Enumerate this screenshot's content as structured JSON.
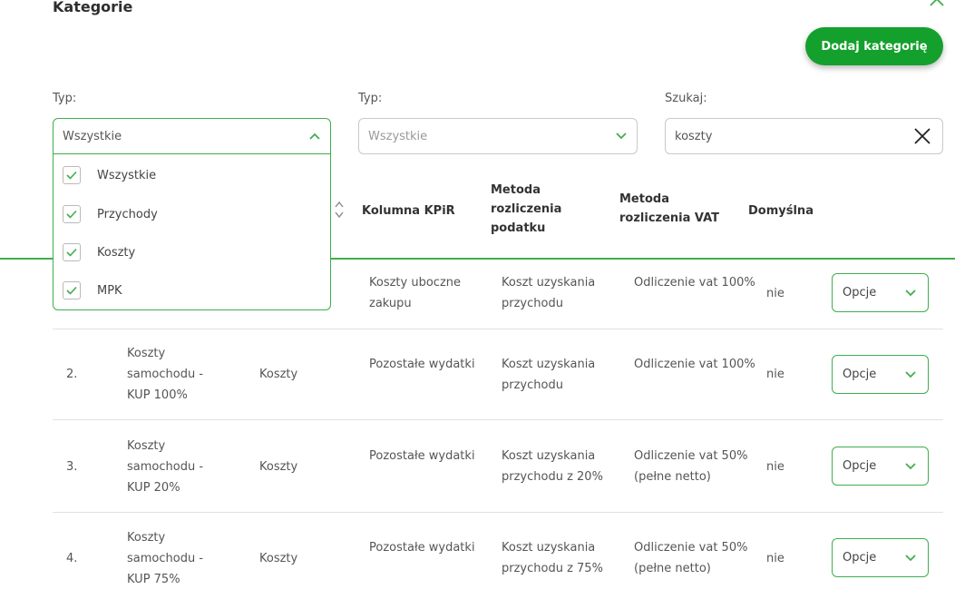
{
  "header": {
    "title": "Kategorie",
    "add_button": "Dodaj kategorię"
  },
  "filters": {
    "type1": {
      "label": "Typ:",
      "value": "Wszystkie"
    },
    "type2": {
      "label": "Typ:",
      "value": "Wszystkie"
    },
    "search": {
      "label": "Szukaj:",
      "value": "koszty"
    }
  },
  "dropdown": {
    "options": [
      {
        "label": "Wszystkie",
        "checked": true
      },
      {
        "label": "Przychody",
        "checked": true
      },
      {
        "label": "Koszty",
        "checked": true
      },
      {
        "label": "MPK",
        "checked": true
      }
    ]
  },
  "table": {
    "columns": [
      "Kolumna KPiR",
      "Metoda rozliczenia podatku",
      "Metoda rozliczenia VAT",
      "Domyślna"
    ],
    "options_label": "Opcje",
    "rows": [
      {
        "num": "",
        "name": "",
        "type": "",
        "kpir": "Koszty uboczne zakupu",
        "tax": "Koszt uzyskania przychodu",
        "vat": "Odliczenie vat 100%",
        "default": "nie"
      },
      {
        "num": "2.",
        "name": "Koszty samochodu - KUP 100%",
        "type": "Koszty",
        "kpir": "Pozostałe wydatki",
        "tax": "Koszt uzyskania przychodu",
        "vat": "Odliczenie vat 100%",
        "default": "nie"
      },
      {
        "num": "3.",
        "name": "Koszty samochodu - KUP 20%",
        "type": "Koszty",
        "kpir": "Pozostałe wydatki",
        "tax": "Koszt uzyskania przychodu z 20%",
        "vat": "Odliczenie vat 50% (pełne netto)",
        "default": "nie"
      },
      {
        "num": "4.",
        "name": "Koszty samochodu - KUP 75%",
        "type": "Koszty",
        "kpir": "Pozostałe wydatki",
        "tax": "Koszt uzyskania przychodu z 75%",
        "vat": "Odliczenie vat 50% (pełne netto)",
        "default": "nie"
      }
    ]
  },
  "colors": {
    "accent": "#14a02c",
    "border_accent": "#3fae4e"
  }
}
